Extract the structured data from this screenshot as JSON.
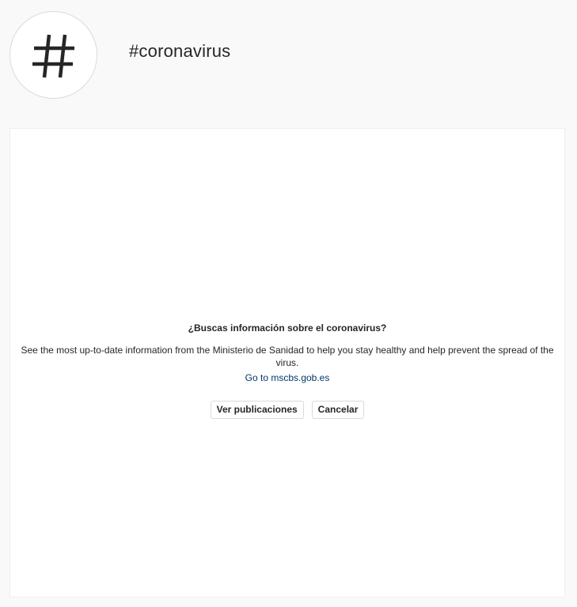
{
  "header": {
    "avatar_icon": "hashtag-icon",
    "tag": "#coronavirus"
  },
  "notice": {
    "title": "¿Buscas información sobre el coronavirus?",
    "body": "See the most up-to-date information from the Ministerio de Sanidad to help you stay healthy and help prevent the spread of the virus.",
    "link": "Go to mscbs.gob.es",
    "buttons": {
      "view_posts": "Ver publicaciones",
      "cancel": "Cancelar"
    }
  },
  "colors": {
    "page_background": "#f9f9f9",
    "panel_background": "#ffffff",
    "text": "#262626",
    "link": "#00376b",
    "border": "#dbdbdb"
  }
}
